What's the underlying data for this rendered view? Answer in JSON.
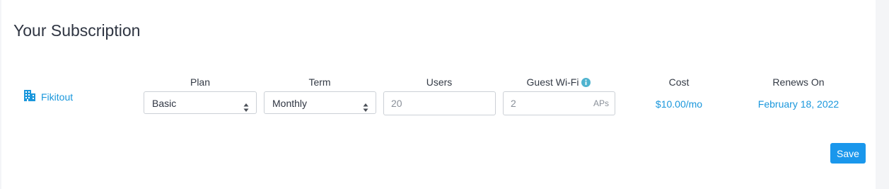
{
  "page": {
    "title": "Your Subscription"
  },
  "columns": {
    "plan": "Plan",
    "term": "Term",
    "users": "Users",
    "guest_wifi": "Guest Wi-Fi",
    "cost": "Cost",
    "renews_on": "Renews On"
  },
  "row": {
    "account_name": "Fikitout",
    "account_icon": "building-icon",
    "plan_value": "Basic",
    "term_value": "Monthly",
    "users_value": "20",
    "guest_wifi_value": "2",
    "guest_wifi_suffix": "APs",
    "cost_value": "$10.00/mo",
    "renews_on_value": "February 18, 2022"
  },
  "actions": {
    "save_label": "Save"
  },
  "colors": {
    "accent": "#1a97dc",
    "button": "#1a97ec",
    "info": "#4fb3cf"
  }
}
